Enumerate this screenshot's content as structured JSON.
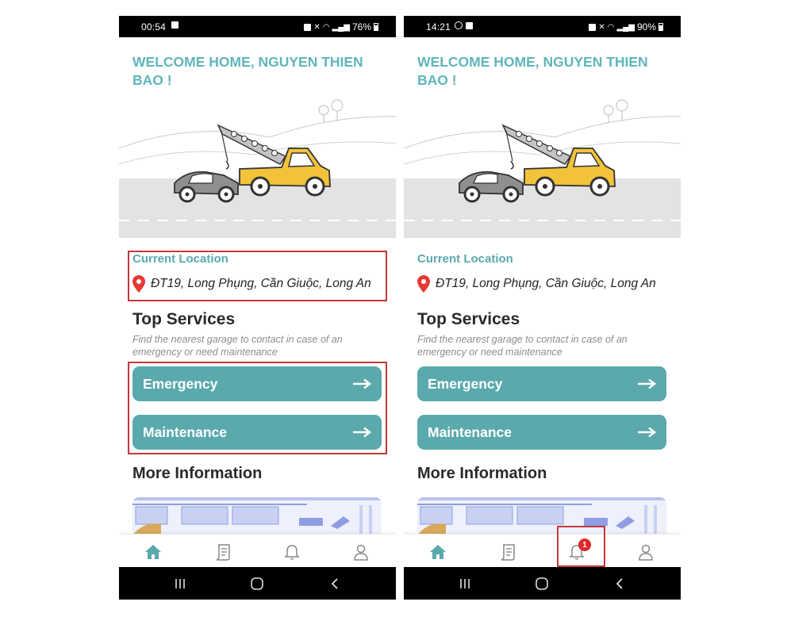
{
  "phones": [
    {
      "status": {
        "time": "00:54",
        "battery": "76%"
      },
      "welcome": "WELCOME HOME, NGUYEN THIEN BAO !",
      "location": {
        "title": "Current Location",
        "address": "ĐT19, Long Phụng, Cần Giuộc, Long An"
      },
      "services": {
        "title": "Top Services",
        "subtitle": "Find the nearest garage to contact in case of an emergency or need maintenance",
        "emergency_label": "Emergency",
        "maintenance_label": "Maintenance"
      },
      "more_info": {
        "title": "More Information"
      },
      "bottom_nav": {
        "items": [
          "home-icon",
          "orders-icon",
          "bell-icon",
          "profile-icon"
        ],
        "active": "home",
        "notification_badge": ""
      },
      "highlights": [
        "current-location-section",
        "service-buttons"
      ]
    },
    {
      "status": {
        "time": "14:21",
        "battery": "90%"
      },
      "welcome": "WELCOME HOME, NGUYEN THIEN BAO !",
      "location": {
        "title": "Current Location",
        "address": "ĐT19, Long Phụng, Cần Giuộc, Long An"
      },
      "services": {
        "title": "Top Services",
        "subtitle": "Find the nearest garage to contact in case of an emergency or need maintenance",
        "emergency_label": "Emergency",
        "maintenance_label": "Maintenance"
      },
      "more_info": {
        "title": "More Information"
      },
      "bottom_nav": {
        "items": [
          "home-icon",
          "orders-icon",
          "bell-icon",
          "profile-icon"
        ],
        "active": "home",
        "notification_badge": "1"
      },
      "highlights": [
        "notification-tab"
      ]
    }
  ],
  "theme": {
    "accent": "#5aa9ac",
    "title_color": "#5fb6bb",
    "highlight_color": "#c6373a",
    "badge_color": "#e0282b",
    "pin_color": "#e53935"
  }
}
